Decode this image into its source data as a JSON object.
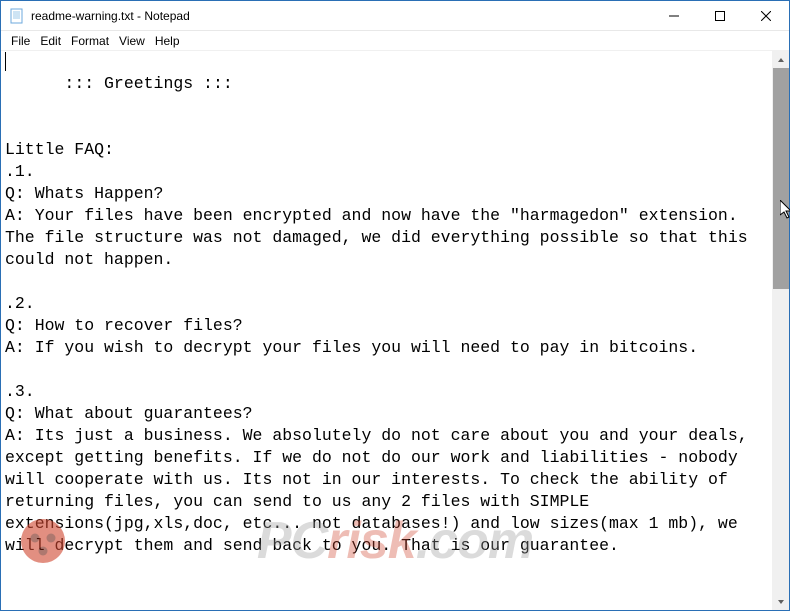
{
  "titlebar": {
    "title": "readme-warning.txt - Notepad"
  },
  "winctrl": {
    "min": "—",
    "max": "☐",
    "close": "✕"
  },
  "menu": {
    "file": "File",
    "edit": "Edit",
    "format": "Format",
    "view": "View",
    "help": "Help"
  },
  "document": {
    "text": "::: Greetings :::\n\n\nLittle FAQ:\n.1.\nQ: Whats Happen?\nA: Your files have been encrypted and now have the \"harmagedon\" extension. The file structure was not damaged, we did everything possible so that this could not happen.\n\n.2.\nQ: How to recover files?\nA: If you wish to decrypt your files you will need to pay in bitcoins.\n\n.3.\nQ: What about guarantees?\nA: Its just a business. We absolutely do not care about you and your deals, except getting benefits. If we do not do our work and liabilities - nobody will cooperate with us. Its not in our interests. To check the ability of returning files, you can send to us any 2 files with SIMPLE extensions(jpg,xls,doc, etc... not databases!) and low sizes(max 1 mb), we will decrypt them and send back to you. That is our guarantee."
  },
  "watermark": {
    "pc": "PC",
    "risk": "risk",
    "dotcom": ".com"
  }
}
